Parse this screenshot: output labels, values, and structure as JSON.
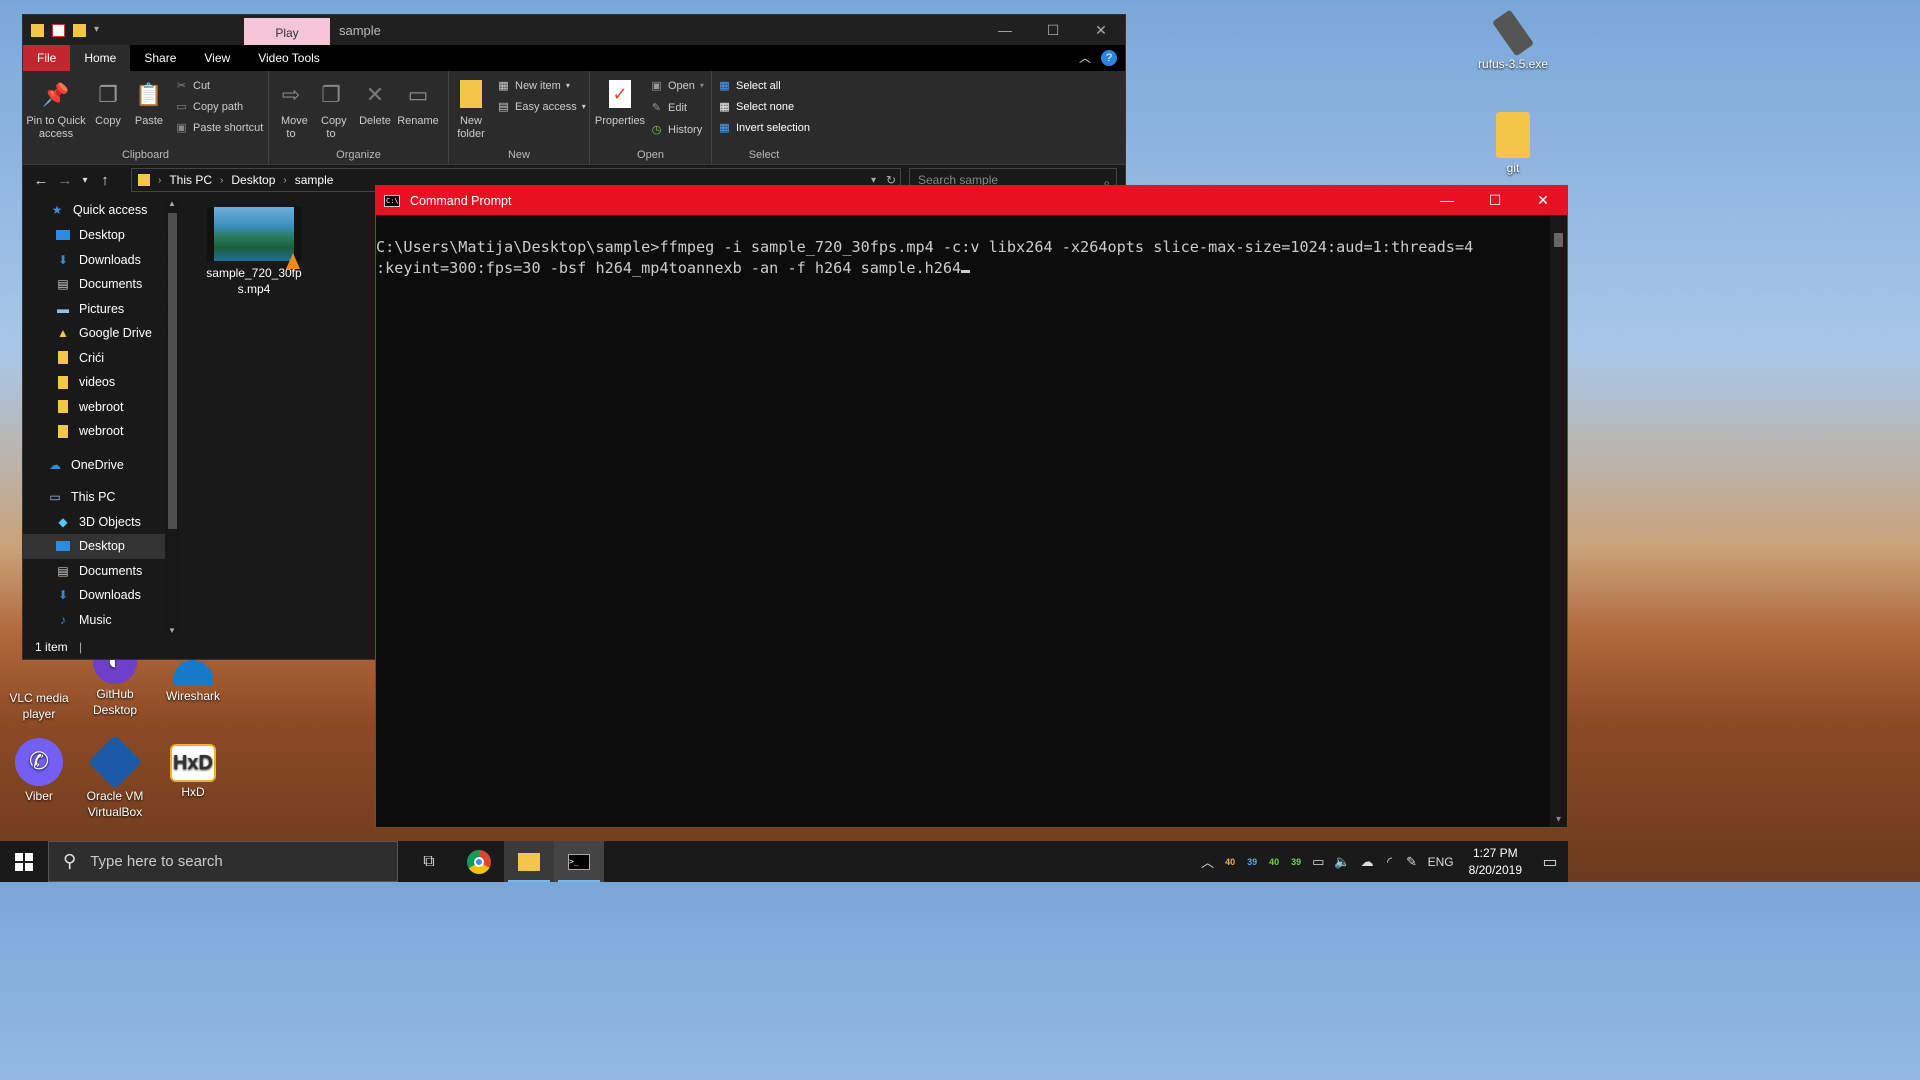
{
  "desktop": {
    "icons": [
      {
        "label": "VLC media player",
        "icon": "vlc-icon"
      },
      {
        "label": "GitHub Desktop",
        "icon": "github-icon"
      },
      {
        "label": "Wireshark",
        "icon": "wireshark-icon"
      },
      {
        "label": "Viber",
        "icon": "viber-icon"
      },
      {
        "label": "Oracle VM VirtualBox",
        "icon": "virtualbox-icon"
      },
      {
        "label": "HxD",
        "icon": "hxd-icon"
      },
      {
        "label": "rufus-3.5.exe",
        "icon": "usb-icon"
      },
      {
        "label": "git",
        "icon": "folder-icon"
      }
    ]
  },
  "explorer": {
    "window_title": "sample",
    "context_tab": "Play",
    "tabs": [
      "File",
      "Home",
      "Share",
      "View",
      "Video Tools"
    ],
    "ribbon": {
      "clipboard": {
        "label": "Clipboard",
        "pin": "Pin to Quick access",
        "copy": "Copy",
        "paste": "Paste",
        "cut": "Cut",
        "copy_path": "Copy path",
        "paste_shortcut": "Paste shortcut"
      },
      "organize": {
        "label": "Organize",
        "move_to": "Move to",
        "copy_to": "Copy to",
        "delete": "Delete",
        "rename": "Rename"
      },
      "new": {
        "label": "New",
        "new_folder": "New folder",
        "new_item": "New item",
        "easy_access": "Easy access"
      },
      "open": {
        "label": "Open",
        "properties": "Properties",
        "open": "Open",
        "edit": "Edit",
        "history": "History"
      },
      "select": {
        "label": "Select",
        "select_all": "Select all",
        "select_none": "Select none",
        "invert": "Invert selection"
      }
    },
    "breadcrumb": [
      "This PC",
      "Desktop",
      "sample"
    ],
    "search_placeholder": "Search sample",
    "nav": {
      "quick_access": "Quick access",
      "quick_items": [
        {
          "label": "Desktop",
          "pinned": true
        },
        {
          "label": "Downloads",
          "pinned": true
        },
        {
          "label": "Documents",
          "pinned": true
        },
        {
          "label": "Pictures",
          "pinned": true
        },
        {
          "label": "Google Drive",
          "pinned": true
        },
        {
          "label": "Crići",
          "pinned": false
        },
        {
          "label": "videos",
          "pinned": false
        },
        {
          "label": "webroot",
          "pinned": false
        },
        {
          "label": "webroot",
          "pinned": false
        }
      ],
      "onedrive": "OneDrive",
      "this_pc": "This PC",
      "pc_items": [
        "3D Objects",
        "Desktop",
        "Documents",
        "Downloads",
        "Music"
      ],
      "selected": "Desktop"
    },
    "file": {
      "name": "sample_720_30fps.mp4"
    },
    "status": "1 item"
  },
  "cmd": {
    "title": "Command Prompt",
    "line1": "C:\\Users\\Matija\\Desktop\\sample>ffmpeg -i sample_720_30fps.mp4 -c:v libx264 -x264opts slice-max-size=1024:aud=1:threads=4",
    "line2": ":keyint=300:fps=30 -bsf h264_mp4toannexb -an -f h264 sample.h264"
  },
  "taskbar": {
    "search_placeholder": "Type here to search",
    "temps": [
      "40",
      "39",
      "40",
      "39"
    ],
    "temp_colors": [
      "#e8b84a",
      "#5aa0e6",
      "#6fcf4a",
      "#6fcf4a"
    ],
    "language": "ENG",
    "time": "1:27 PM",
    "date": "8/20/2019"
  }
}
